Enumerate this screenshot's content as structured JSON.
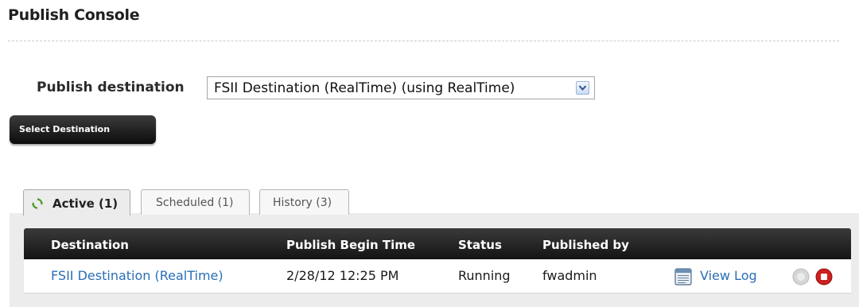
{
  "page": {
    "title": "Publish Console"
  },
  "destination": {
    "label": "Publish destination",
    "selected": "FSII Destination (RealTime) (using RealTime)",
    "button_label": "Select Destination"
  },
  "tabs": [
    {
      "label": "Active (1)",
      "active": true,
      "icon": "refresh-icon"
    },
    {
      "label": "Scheduled (1)",
      "active": false
    },
    {
      "label": "History (3)",
      "active": false
    }
  ],
  "grid": {
    "columns": [
      "Destination",
      "Publish Begin Time",
      "Status",
      "Published by"
    ],
    "rows": [
      {
        "destination": "FSII Destination (RealTime)",
        "begin_time": "2/28/12 12:25 PM",
        "status": "Running",
        "published_by": "fwadmin",
        "log_label": "View Log",
        "icons": [
          "log-icon",
          "disabled-action-icon",
          "stop-icon"
        ]
      }
    ]
  },
  "colors": {
    "link": "#2a6fb5",
    "header_bg": "#1e1e1e",
    "stop": "#cc1f1f",
    "refresh": "#4a9a2a"
  }
}
